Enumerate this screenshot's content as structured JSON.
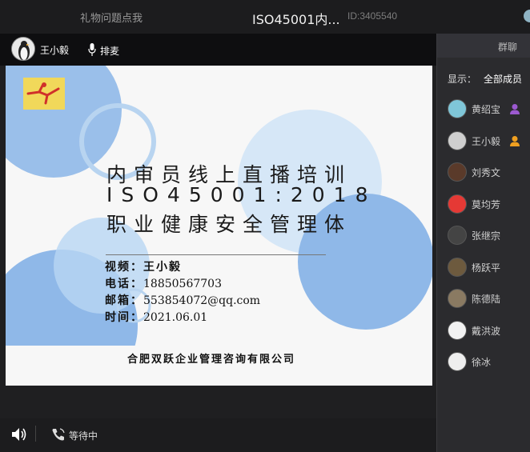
{
  "topbar": {
    "gift_label": "礼物问题点我",
    "title": "ISO45001内...",
    "room_id": "ID:3405540"
  },
  "host": {
    "name": "王小毅",
    "mic_label": "排麦"
  },
  "slide": {
    "line1": "内审员线上直播培训",
    "line2": "ISO45001:2018",
    "line3": "职业健康安全管理体",
    "info": [
      {
        "key": "视频：",
        "value": "王小毅"
      },
      {
        "key": "电话：",
        "value": "18850567703"
      },
      {
        "key": "邮箱：",
        "value": "553854072@qq.com"
      },
      {
        "key": "时间：",
        "value": "2021.06.01"
      }
    ],
    "company": "合肥双跃企业管理咨询有限公司"
  },
  "bottombar": {
    "status": "等待中"
  },
  "panel": {
    "header": "群聊",
    "filter_label": "显示：",
    "filter_value": "全部成员",
    "members": [
      {
        "name": "黄绍宝",
        "avatar_color": "#7fc6d8",
        "role": "admin"
      },
      {
        "name": "王小毅",
        "avatar_color": "#cfcfcf",
        "role": "host"
      },
      {
        "name": "刘秀文",
        "avatar_color": "#5a3a2a",
        "role": ""
      },
      {
        "name": "莫均芳",
        "avatar_color": "#e53935",
        "role": ""
      },
      {
        "name": "张继宗",
        "avatar_color": "#444444",
        "role": ""
      },
      {
        "name": "杨跃平",
        "avatar_color": "#6d5a3e",
        "role": ""
      },
      {
        "name": "陈德陆",
        "avatar_color": "#8a7a62",
        "role": ""
      },
      {
        "name": "戴洪波",
        "avatar_color": "#f2f2f2",
        "role": ""
      },
      {
        "name": "徐冰",
        "avatar_color": "#eeeeee",
        "role": ""
      }
    ]
  },
  "colors": {
    "accent_admin": "#9b59d0",
    "accent_host": "#f0a020",
    "slide_circle": "#8fb8e8"
  }
}
